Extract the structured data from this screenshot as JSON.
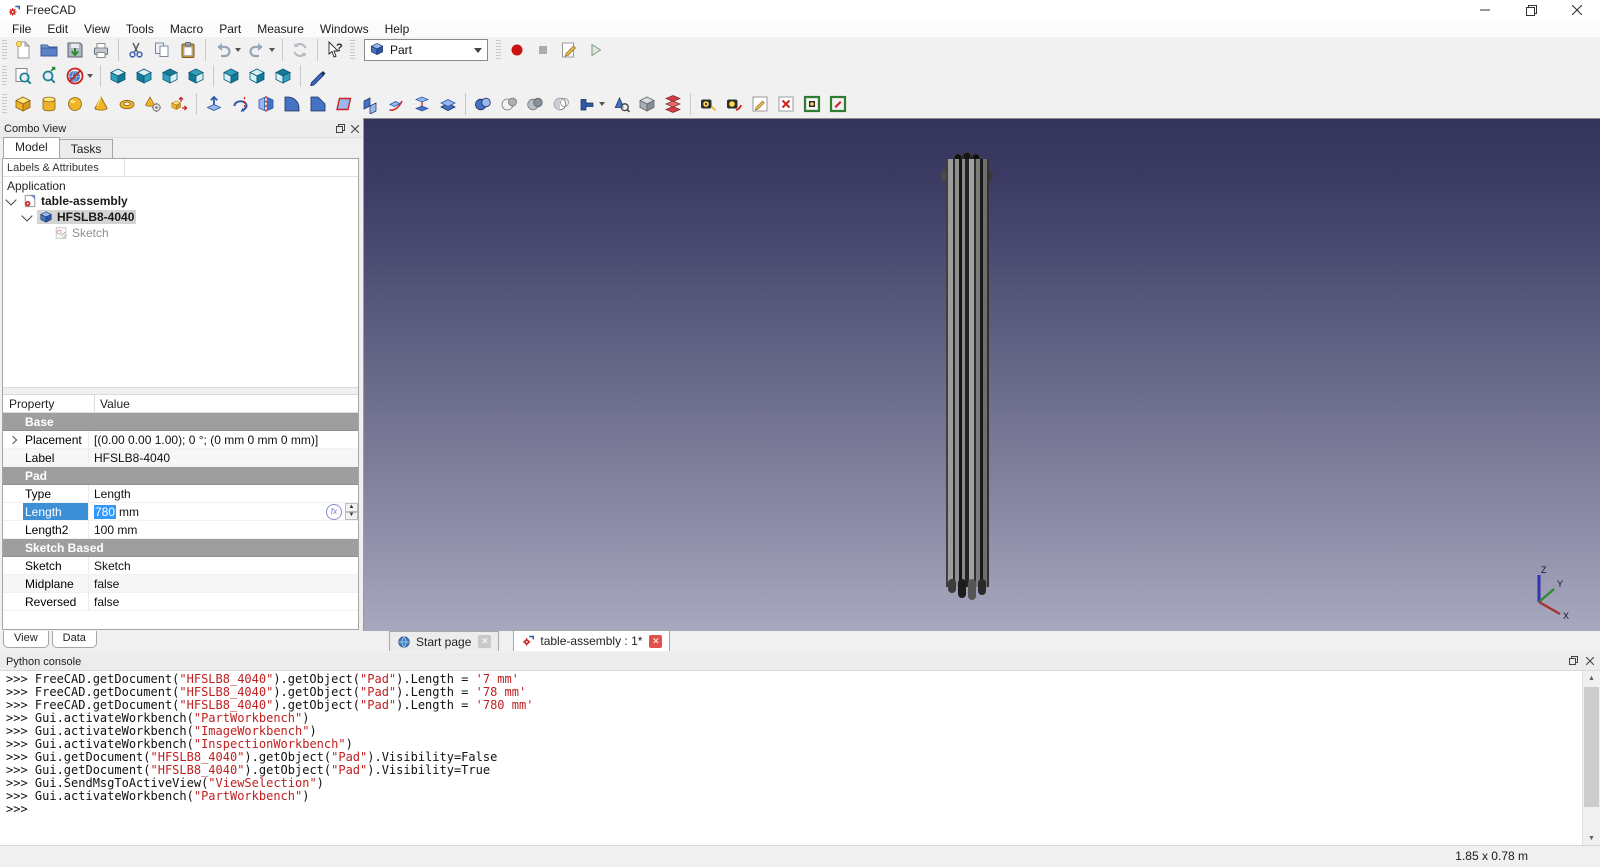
{
  "window": {
    "title": "FreeCAD"
  },
  "menubar": [
    "File",
    "Edit",
    "View",
    "Tools",
    "Macro",
    "Part",
    "Measure",
    "Windows",
    "Help"
  ],
  "toolbars": {
    "standard": {
      "groups": [
        [
          "new-file",
          "open-folder",
          "save",
          "print"
        ],
        [
          "cut",
          "copy",
          "paste"
        ],
        [
          {
            "name": "undo",
            "dropdown": true
          },
          {
            "name": "redo",
            "dropdown": true
          }
        ],
        [
          "refresh"
        ],
        [
          "whats-this"
        ]
      ]
    },
    "workbench": {
      "selected": "Part",
      "icon": "workbench-cube"
    },
    "macro": {
      "items": [
        "macro-record",
        "macro-stop",
        "macro-edit",
        "macro-play"
      ]
    },
    "view": {
      "groups": [
        [
          "fit-all",
          "fit-selection",
          {
            "name": "draw-style",
            "dropdown": true
          }
        ],
        [
          "view-axonometric",
          "view-front",
          "view-top",
          "view-right"
        ],
        [
          "view-rear",
          "view-bottom",
          "view-left"
        ],
        [
          "measure-pen"
        ]
      ]
    },
    "part": {
      "groups": [
        [
          "primitive-box",
          "primitive-cylinder",
          "primitive-sphere",
          "primitive-cone",
          "primitive-torus",
          "create-primitives",
          "shape-builder"
        ],
        [
          "extrude",
          "revolve",
          "mirror",
          "fillet",
          "chamfer",
          "make-face",
          "ruled-surface",
          "sweep",
          "loft",
          "thickness"
        ],
        [
          "boolean-union",
          "boolean-cut",
          "boolean-common",
          "boolean-section",
          {
            "name": "boolean-operation",
            "dropdown": true
          },
          "check-geometry",
          "defeaturing",
          "cross-sections"
        ],
        [
          "measure-linear",
          "measure-angular",
          "measure-refresh",
          "measure-clear-all",
          "measure-toggle-all",
          "measure-toggle-3d"
        ]
      ]
    }
  },
  "combo_view": {
    "title": "Combo View",
    "tabs": [
      {
        "label": "Model",
        "active": true
      },
      {
        "label": "Tasks",
        "active": false
      }
    ],
    "tree_header": "Labels & Attributes",
    "tree_root": "Application",
    "tree_items": [
      {
        "label": "table-assembly",
        "icon": "document",
        "level": 1,
        "bold": true,
        "expanded": true
      },
      {
        "label": "HFSLB8-4040",
        "icon": "part",
        "level": 2,
        "bold": true,
        "selected": true,
        "expanded": true
      },
      {
        "label": "Sketch",
        "icon": "sketch",
        "level": 3,
        "disabled": true
      }
    ],
    "properties": {
      "columns": [
        "Property",
        "Value"
      ],
      "rows": [
        {
          "kind": "group",
          "label": "Base"
        },
        {
          "kind": "value",
          "label": "Placement",
          "value": "[(0.00 0.00 1.00); 0 °; (0 mm  0 mm  0 mm)]",
          "expandable": true
        },
        {
          "kind": "value",
          "label": "Label",
          "value": "HFSLB8-4040",
          "alt": true
        },
        {
          "kind": "group",
          "label": "Pad"
        },
        {
          "kind": "value",
          "label": "Type",
          "value": "Length"
        },
        {
          "kind": "edit",
          "label": "Length",
          "value": "780",
          "suffix": " mm",
          "selected": true
        },
        {
          "kind": "value",
          "label": "Length2",
          "value": "100 mm"
        },
        {
          "kind": "group",
          "label": "Sketch Based"
        },
        {
          "kind": "value",
          "label": "Sketch",
          "value": "Sketch"
        },
        {
          "kind": "value",
          "label": "Midplane",
          "value": "false",
          "alt": true
        },
        {
          "kind": "value",
          "label": "Reversed",
          "value": "false"
        }
      ]
    },
    "bottom_tabs": [
      {
        "label": "View",
        "active": false
      },
      {
        "label": "Data",
        "active": true
      }
    ]
  },
  "viewport": {
    "gradient_top": "#33335b",
    "gradient_bottom": "#a8a8bf",
    "model_name": "HFSLB8-4040 aluminum extrusion profile",
    "axis_labels": {
      "x": "X",
      "y": "Y",
      "z": "Z"
    },
    "axis_colors": {
      "x": "#a83030",
      "y": "#2e8b2e",
      "z": "#3434b0"
    }
  },
  "mdi_tabs": [
    {
      "label": "Start page",
      "icon": "globe",
      "active": false
    },
    {
      "label": "table-assembly : 1*",
      "icon": "freecad",
      "active": true
    }
  ],
  "python_console": {
    "title": "Python console",
    "string_color": "#c02020",
    "lines": [
      ">>> FreeCAD.getDocument(\"HFSLB8_4040\").getObject(\"Pad\").Length = '7 mm'",
      ">>> FreeCAD.getDocument(\"HFSLB8_4040\").getObject(\"Pad\").Length = '78 mm'",
      ">>> FreeCAD.getDocument(\"HFSLB8_4040\").getObject(\"Pad\").Length = '780 mm'",
      ">>> Gui.activateWorkbench(\"PartWorkbench\")",
      ">>> Gui.activateWorkbench(\"ImageWorkbench\")",
      ">>> Gui.activateWorkbench(\"InspectionWorkbench\")",
      ">>> Gui.getDocument(\"HFSLB8_4040\").getObject(\"Pad\").Visibility=False",
      ">>> Gui.getDocument(\"HFSLB8_4040\").getObject(\"Pad\").Visibility=True",
      ">>> Gui.SendMsgToActiveView(\"ViewSelection\")",
      ">>> Gui.activateWorkbench(\"PartWorkbench\")",
      ">>>"
    ]
  },
  "statusbar": {
    "dimensions": "1.85 x 0.78 m"
  }
}
